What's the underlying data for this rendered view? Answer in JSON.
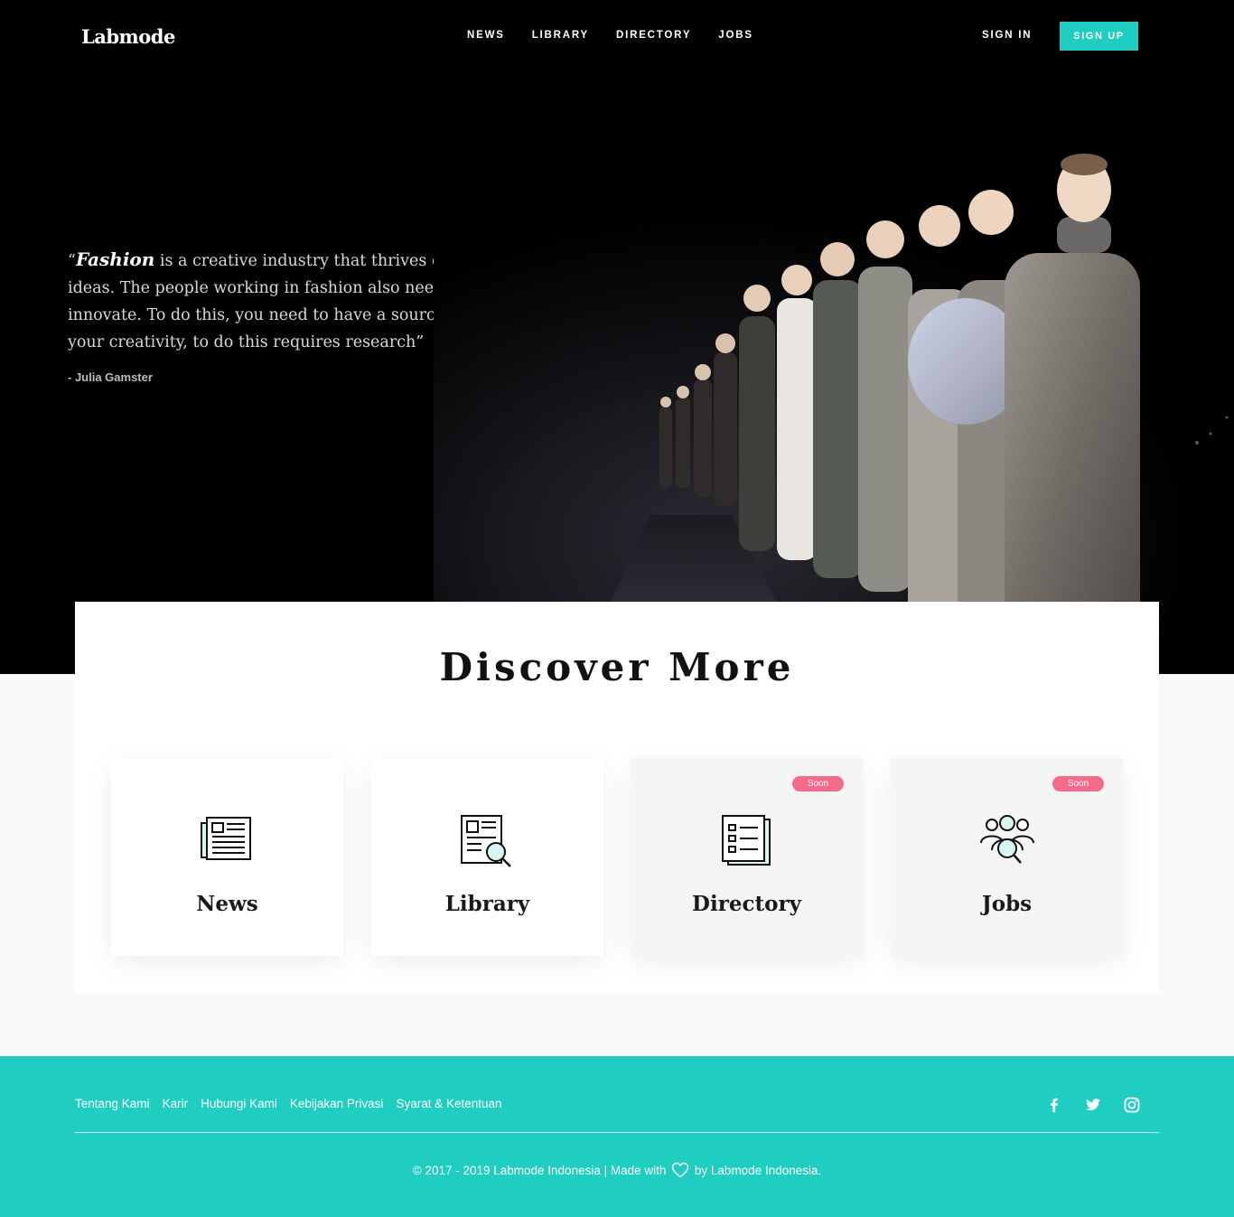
{
  "brand": {
    "logo": "Labmode"
  },
  "nav": {
    "links": [
      "NEWS",
      "LIBRARY",
      "DIRECTORY",
      "JOBS"
    ],
    "sign_in": "SIGN IN",
    "sign_up": "SIGN UP"
  },
  "hero": {
    "quote_open": "“",
    "quote_emphasis": "Fashion",
    "quote_rest": " is a creative industry that thrives on a constant flow of ideas. The people working in fashion also need to be creative and to innovate. To do this, you need to have a source from which to feed your creativity, to do this requires research”",
    "author": "- Julia Gamster"
  },
  "discover": {
    "title": "Discover More",
    "cards": [
      {
        "label": "News",
        "icon": "newspaper-icon",
        "badge": ""
      },
      {
        "label": "Library",
        "icon": "document-search-icon",
        "badge": ""
      },
      {
        "label": "Directory",
        "icon": "directory-list-icon",
        "badge": "Soon"
      },
      {
        "label": "Jobs",
        "icon": "people-search-icon",
        "badge": "Soon"
      }
    ]
  },
  "footer": {
    "links": [
      "Tentang Kami",
      "Karir",
      "Hubungi Kami",
      "Kebijakan Privasi",
      "Syarat & Ketentuan"
    ],
    "social": [
      "facebook-icon",
      "twitter-icon",
      "instagram-icon"
    ],
    "copyright_left": "© 2017 - 2019 Labmode Indonesia | Made with",
    "copyright_right": "by Labmode Indonesia."
  },
  "colors": {
    "accent": "#1fcdc1",
    "badge": "#f36b8c",
    "hero_bg": "#000000",
    "page_bg": "#f9f9f9"
  }
}
